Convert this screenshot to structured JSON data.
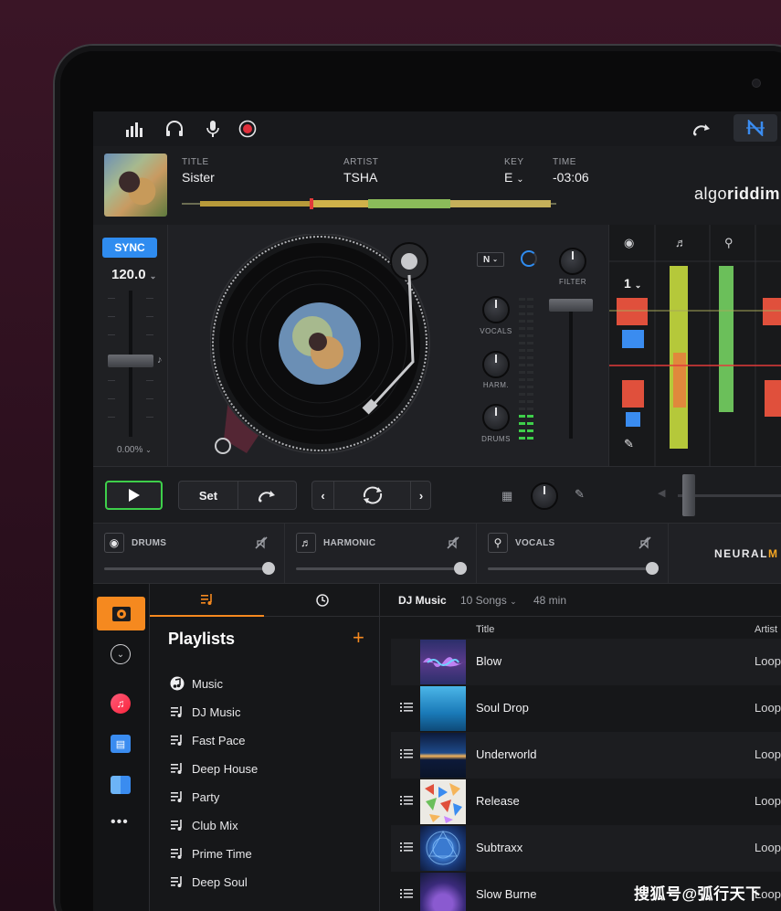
{
  "track": {
    "title_label": "TITLE",
    "title": "Sister",
    "artist_label": "ARTIST",
    "artist": "TSHA",
    "key_label": "KEY",
    "key": "E",
    "time_label": "TIME",
    "time": "-03:06"
  },
  "brand": {
    "logo_light": "algo",
    "logo_bold": "riddim"
  },
  "deck": {
    "sync_label": "SYNC",
    "bpm": "120.0",
    "pitch": "0.00%",
    "mixer_mode": "N",
    "filter_label": "FILTER",
    "vocals_label": "VOCALS",
    "harm_label": "HARM.",
    "drums_label": "DRUMS",
    "beat_count": "1"
  },
  "transport": {
    "set_label": "Set"
  },
  "stems": [
    {
      "label": "DRUMS"
    },
    {
      "label": "HARMONIC"
    },
    {
      "label": "VOCALS"
    }
  ],
  "neural_mix": {
    "label_light": "NEURAL",
    "label_accent": "M"
  },
  "playlists": {
    "title": "Playlists",
    "add": "+",
    "items": [
      {
        "label": "Music",
        "icon": "music-app-icon"
      },
      {
        "label": "DJ Music",
        "icon": "playlist-icon"
      },
      {
        "label": "Fast Pace",
        "icon": "playlist-icon"
      },
      {
        "label": "Deep House",
        "icon": "playlist-icon"
      },
      {
        "label": "Party",
        "icon": "playlist-icon"
      },
      {
        "label": "Club Mix",
        "icon": "playlist-icon"
      },
      {
        "label": "Prime Time",
        "icon": "playlist-icon"
      },
      {
        "label": "Deep Soul",
        "icon": "playlist-icon"
      }
    ]
  },
  "songs": {
    "playlist_name": "DJ Music",
    "count": "10 Songs",
    "duration": "48 min",
    "col_title": "Title",
    "col_artist": "Artist",
    "rows": [
      {
        "title": "Blow",
        "artist": "Loopr"
      },
      {
        "title": "Soul Drop",
        "artist": "Loopr"
      },
      {
        "title": "Underworld",
        "artist": "Loopr"
      },
      {
        "title": "Release",
        "artist": "Loopr"
      },
      {
        "title": "Subtraxx",
        "artist": "Loopr"
      },
      {
        "title": "Slow Burne",
        "artist": "Loopr"
      }
    ]
  },
  "watermark": "搜狐号@弧行天下",
  "colors": {
    "accent": "#f5891f",
    "sync": "#2f8cf0",
    "play": "#3ecf4a",
    "record": "#e0303c"
  }
}
